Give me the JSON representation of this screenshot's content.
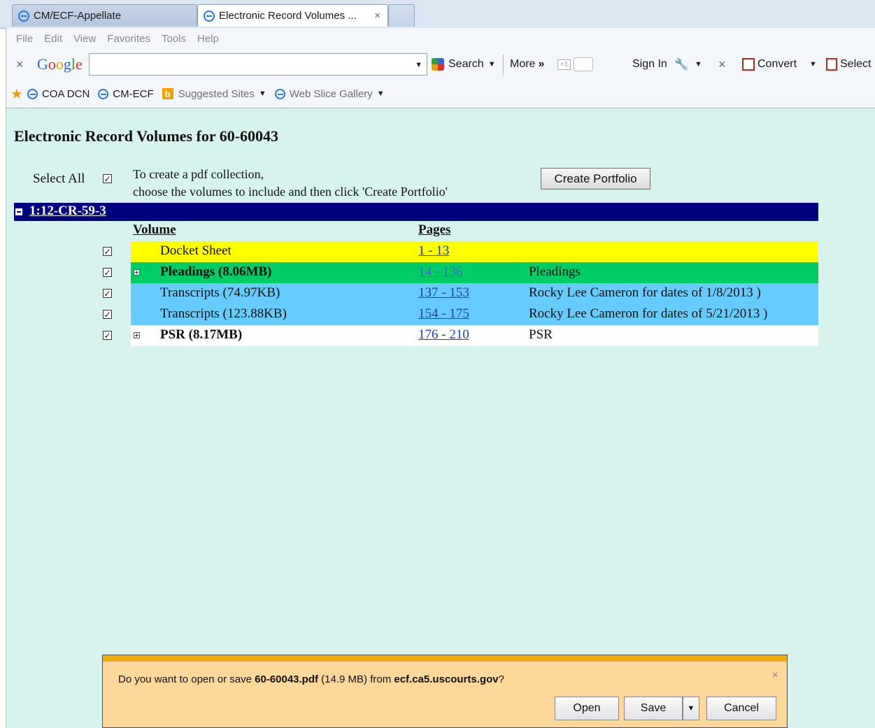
{
  "browser": {
    "tabs": [
      {
        "label": "CM/ECF-Appellate",
        "active": false
      },
      {
        "label": "Electronic Record Volumes ...",
        "active": true
      }
    ],
    "tab_close": "×",
    "menu": [
      "File",
      "Edit",
      "View",
      "Favorites",
      "Tools",
      "Help"
    ],
    "google_toolbar": {
      "close": "×",
      "logo": [
        "G",
        "o",
        "o",
        "g",
        "l",
        "e"
      ],
      "search_value": "",
      "search_label": "Search",
      "more_label": "More",
      "more_chevron": "»",
      "plus_one": "+1",
      "sign_in": "Sign In",
      "close2": "×",
      "convert": "Convert",
      "select": "Select"
    },
    "favorites": [
      {
        "label": "COA DCN",
        "icon": "ie-icon"
      },
      {
        "label": "CM-ECF",
        "icon": "ie-icon"
      },
      {
        "label": "Suggested Sites",
        "icon": "bing-icon",
        "dropdown": true
      },
      {
        "label": "Web Slice Gallery",
        "icon": "ie-icon",
        "dropdown": true
      }
    ],
    "bing_glyph": "b"
  },
  "page": {
    "title": "Electronic Record Volumes for 60-60043",
    "select_all_label": "Select All",
    "select_all_checked": true,
    "instructions_line1": "To create a pdf collection,",
    "instructions_line2": "choose the volumes to include and then click 'Create Portfolio'",
    "create_button": "Create Portfolio",
    "case_number": "1:12-CR-59-3",
    "columns": {
      "volume": "Volume",
      "pages": "Pages"
    },
    "volumes": [
      {
        "name": "Docket Sheet",
        "pages": "1 - 13",
        "description": "",
        "bg": "#ffff00",
        "bold": false,
        "expandable": false,
        "checked": true
      },
      {
        "name": "Pleadings (8.06MB)",
        "pages": "14 - 136",
        "description": "Pleadings",
        "bg": "#00cc66",
        "bold": true,
        "expandable": true,
        "checked": true
      },
      {
        "name": "Transcripts (74.97KB)",
        "pages": "137 - 153",
        "description": "Rocky Lee Cameron for dates of 1/8/2013 )",
        "bg": "#66ccff",
        "bold": false,
        "expandable": false,
        "checked": true
      },
      {
        "name": "Transcripts (123.88KB)",
        "pages": "154 - 175",
        "description": "Rocky Lee Cameron for dates of 5/21/2013 )",
        "bg": "#66ccff",
        "bold": false,
        "expandable": false,
        "checked": true
      },
      {
        "name": "PSR (8.17MB)",
        "pages": "176 - 210",
        "description": "PSR",
        "bg": "#ffffff",
        "bold": true,
        "expandable": true,
        "checked": true
      }
    ]
  },
  "download_bar": {
    "prefix": "Do you want to open or save ",
    "filename": "60-60043.pdf",
    "size": " (14.9 MB) from ",
    "host": "ecf.ca5.uscourts.gov",
    "suffix": "?",
    "close": "×",
    "open_label": "Open",
    "save_label": "Save",
    "cancel_label": "Cancel"
  },
  "colors": {
    "content_bg": "#d7f3ee",
    "case_bar": "#00007c",
    "notify_bg": "#fdd89a",
    "notify_accent": "#ecad10"
  }
}
